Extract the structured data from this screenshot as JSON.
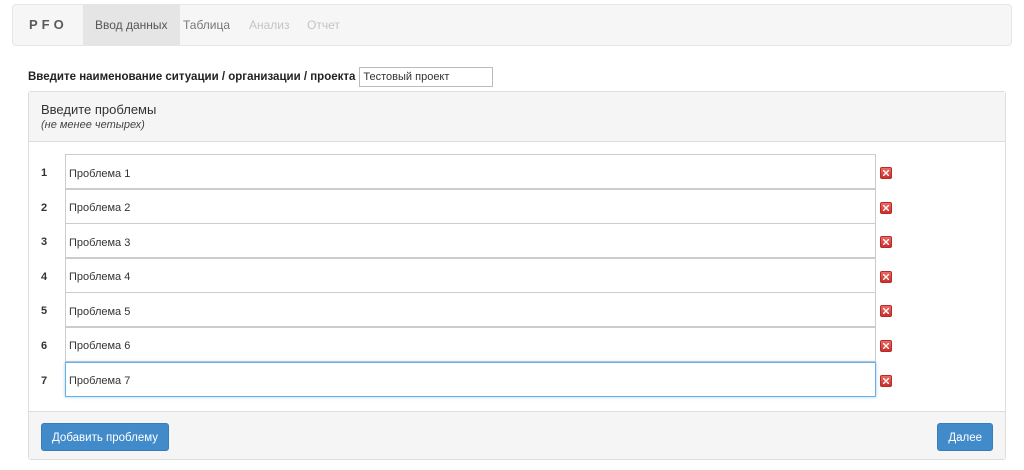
{
  "navbar": {
    "brand": "PFO",
    "tabs": [
      {
        "label": "Ввод данных",
        "state": "active"
      },
      {
        "label": "Таблица",
        "state": "normal"
      },
      {
        "label": "Анализ",
        "state": "disabled"
      },
      {
        "label": "Отчет",
        "state": "disabled"
      }
    ]
  },
  "project": {
    "label": "Введите наименование ситуации / организации / проекта",
    "value": "Тестовый проект"
  },
  "problems_panel": {
    "title": "Введите проблемы",
    "subtitle": "(не менее четырех)",
    "delete_icon": "delete-x-icon",
    "rows": [
      {
        "num": "1",
        "value": "Проблема 1"
      },
      {
        "num": "2",
        "value": "Проблема 2"
      },
      {
        "num": "3",
        "value": "Проблема 3"
      },
      {
        "num": "4",
        "value": "Проблема 4"
      },
      {
        "num": "5",
        "value": "Проблема 5"
      },
      {
        "num": "6",
        "value": "Проблема 6"
      },
      {
        "num": "7",
        "value": "Проблема 7"
      }
    ],
    "focused_row": 7,
    "add_button": "Добавить проблему",
    "next_button": "Далее"
  },
  "colors": {
    "primary": "#428bca",
    "delete": "#d9534f",
    "focus": "#66afe9"
  }
}
